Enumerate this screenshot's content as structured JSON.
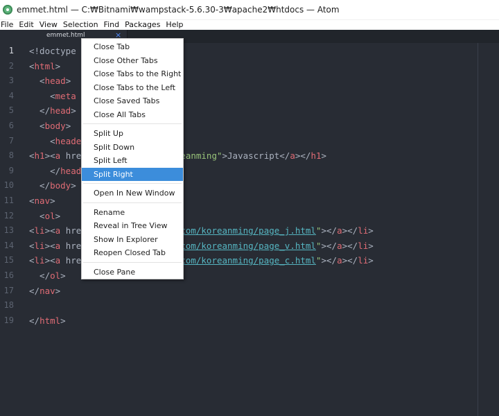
{
  "window": {
    "title": "emmet.html — C:₩Bitnami₩wampstack-5.6.30-3₩apache2₩htdocs — Atom",
    "icon": "atom-icon"
  },
  "menubar": {
    "items": [
      "File",
      "Edit",
      "View",
      "Selection",
      "Find",
      "Packages",
      "Help"
    ]
  },
  "tab": {
    "title": "emmet.html",
    "close_glyph": "×"
  },
  "editor": {
    "active_line": 1,
    "line_numbers": [
      "1",
      "2",
      "3",
      "4",
      "5",
      "6",
      "7",
      "8",
      "9",
      "10",
      "11",
      "12",
      "13",
      "14",
      "15",
      "16",
      "17",
      "18",
      "19"
    ],
    "lines": [
      [
        {
          "t": "<!doctype",
          "c": "plain"
        }
      ],
      [
        {
          "t": "<",
          "c": "plain"
        },
        {
          "t": "html",
          "c": "tag"
        },
        {
          "t": ">",
          "c": "plain"
        }
      ],
      [
        {
          "t": "  <",
          "c": "plain"
        },
        {
          "t": "head",
          "c": "tag"
        },
        {
          "t": ">",
          "c": "plain"
        }
      ],
      [
        {
          "t": "    <",
          "c": "plain"
        },
        {
          "t": "meta",
          "c": "tag"
        }
      ],
      [
        {
          "t": "  </",
          "c": "plain"
        },
        {
          "t": "head",
          "c": "tag"
        },
        {
          "t": ">",
          "c": "plain"
        }
      ],
      [
        {
          "t": "  <",
          "c": "plain"
        },
        {
          "t": "body",
          "c": "tag"
        },
        {
          "t": ">",
          "c": "plain"
        }
      ],
      [
        {
          "t": "    <",
          "c": "plain"
        },
        {
          "t": "heade",
          "c": "tag"
        }
      ],
      [
        {
          "t": "<",
          "c": "plain"
        },
        {
          "t": "h1",
          "c": "tag"
        },
        {
          "t": "><",
          "c": "plain"
        },
        {
          "t": "a",
          "c": "tag"
        },
        {
          "t": " hre",
          "c": "plain"
        },
        {
          "t": "               ",
          "c": "plain"
        },
        {
          "t": "/koreanming\"",
          "c": "str"
        },
        {
          "t": ">Javascript</",
          "c": "plain"
        },
        {
          "t": "a",
          "c": "tag"
        },
        {
          "t": "></",
          "c": "plain"
        },
        {
          "t": "h1",
          "c": "tag"
        },
        {
          "t": ">",
          "c": "plain"
        }
      ],
      [
        {
          "t": "    </",
          "c": "plain"
        },
        {
          "t": "head",
          "c": "tag"
        }
      ],
      [
        {
          "t": "  </",
          "c": "plain"
        },
        {
          "t": "body",
          "c": "tag"
        },
        {
          "t": ">",
          "c": "plain"
        }
      ],
      [
        {
          "t": "<",
          "c": "plain"
        },
        {
          "t": "nav",
          "c": "tag"
        },
        {
          "t": ">",
          "c": "plain"
        }
      ],
      [
        {
          "t": "  <",
          "c": "plain"
        },
        {
          "t": "ol",
          "c": "tag"
        },
        {
          "t": ">",
          "c": "plain"
        }
      ],
      [
        {
          "t": "<",
          "c": "plain"
        },
        {
          "t": "li",
          "c": "tag"
        },
        {
          "t": "><",
          "c": "plain"
        },
        {
          "t": "a",
          "c": "tag"
        },
        {
          "t": " hre",
          "c": "plain"
        },
        {
          "t": "               ",
          "c": "plain"
        },
        {
          "t": "ver.com/koreanming/page_j.html",
          "c": "url"
        },
        {
          "t": "\"",
          "c": "str"
        },
        {
          "t": "></",
          "c": "plain"
        },
        {
          "t": "a",
          "c": "tag"
        },
        {
          "t": "></",
          "c": "plain"
        },
        {
          "t": "li",
          "c": "tag"
        },
        {
          "t": ">",
          "c": "plain"
        }
      ],
      [
        {
          "t": "<",
          "c": "plain"
        },
        {
          "t": "li",
          "c": "tag"
        },
        {
          "t": "><",
          "c": "plain"
        },
        {
          "t": "a",
          "c": "tag"
        },
        {
          "t": " hre",
          "c": "plain"
        },
        {
          "t": "               ",
          "c": "plain"
        },
        {
          "t": "ver.com/koreanming/page_v.html",
          "c": "url"
        },
        {
          "t": "\"",
          "c": "str"
        },
        {
          "t": "></",
          "c": "plain"
        },
        {
          "t": "a",
          "c": "tag"
        },
        {
          "t": "></",
          "c": "plain"
        },
        {
          "t": "li",
          "c": "tag"
        },
        {
          "t": ">",
          "c": "plain"
        }
      ],
      [
        {
          "t": "<",
          "c": "plain"
        },
        {
          "t": "li",
          "c": "tag"
        },
        {
          "t": "><",
          "c": "plain"
        },
        {
          "t": "a",
          "c": "tag"
        },
        {
          "t": " hre",
          "c": "plain"
        },
        {
          "t": "               ",
          "c": "plain"
        },
        {
          "t": "ver.com/koreanming/page_c.html",
          "c": "url"
        },
        {
          "t": "\"",
          "c": "str"
        },
        {
          "t": "></",
          "c": "plain"
        },
        {
          "t": "a",
          "c": "tag"
        },
        {
          "t": "></",
          "c": "plain"
        },
        {
          "t": "li",
          "c": "tag"
        },
        {
          "t": ">",
          "c": "plain"
        }
      ],
      [
        {
          "t": "  </",
          "c": "plain"
        },
        {
          "t": "ol",
          "c": "tag"
        },
        {
          "t": ">",
          "c": "plain"
        }
      ],
      [
        {
          "t": "</",
          "c": "plain"
        },
        {
          "t": "nav",
          "c": "tag"
        },
        {
          "t": ">",
          "c": "plain"
        }
      ],
      [],
      [
        {
          "t": "</",
          "c": "plain"
        },
        {
          "t": "html",
          "c": "tag"
        },
        {
          "t": ">",
          "c": "plain"
        }
      ]
    ]
  },
  "context_menu": {
    "groups": [
      [
        "Close Tab",
        "Close Other Tabs",
        "Close Tabs to the Right",
        "Close Tabs to the Left",
        "Close Saved Tabs",
        "Close All Tabs"
      ],
      [
        "Split Up",
        "Split Down",
        "Split Left",
        "Split Right"
      ],
      [
        "Open In New Window"
      ],
      [
        "Rename",
        "Reveal in Tree View",
        "Show In Explorer",
        "Reopen Closed Tab"
      ],
      [
        "Close Pane"
      ]
    ],
    "selected": "Split Right"
  },
  "colors": {
    "editor_bg": "#282c34",
    "tag": "#e06c75",
    "string": "#98c379",
    "url": "#56b6c2",
    "plain": "#abb2bf",
    "gutter": "#5c6370",
    "menu_highlight": "#3c8ddb"
  }
}
